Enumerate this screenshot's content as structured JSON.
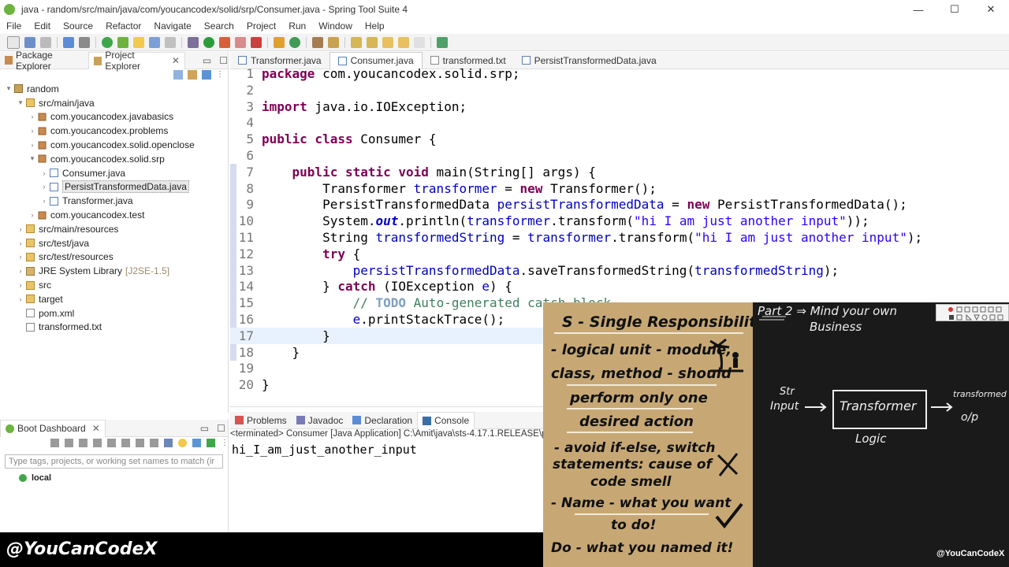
{
  "window": {
    "title": "java - random/src/main/java/com/youcancodex/solid/srp/Consumer.java - Spring Tool Suite 4",
    "minimize": "—",
    "maximize": "☐",
    "close": "✕"
  },
  "menu": [
    "File",
    "Edit",
    "Source",
    "Refactor",
    "Navigate",
    "Search",
    "Project",
    "Run",
    "Window",
    "Help"
  ],
  "left_tabs": [
    {
      "label": "Package Explorer",
      "icon": "package-explorer-icon"
    },
    {
      "label": "Project Explorer",
      "icon": "project-explorer-icon"
    }
  ],
  "tree": [
    {
      "label": "random",
      "icon": "project-icon",
      "indent": 0,
      "toggle": "▾"
    },
    {
      "label": "src/main/java",
      "icon": "source-folder-icon",
      "indent": 1,
      "toggle": "▾"
    },
    {
      "label": "com.youcancodex.javabasics",
      "icon": "package-icon",
      "indent": 2,
      "toggle": "›"
    },
    {
      "label": "com.youcancodex.problems",
      "icon": "package-icon",
      "indent": 2,
      "toggle": "›"
    },
    {
      "label": "com.youcancodex.solid.openclose",
      "icon": "package-icon",
      "indent": 2,
      "toggle": "›"
    },
    {
      "label": "com.youcancodex.solid.srp",
      "icon": "package-icon",
      "indent": 2,
      "toggle": "▾"
    },
    {
      "label": "Consumer.java",
      "icon": "java-file-icon",
      "indent": 3,
      "toggle": "›"
    },
    {
      "label": "PersistTransformedData.java",
      "icon": "java-file-icon",
      "indent": 3,
      "toggle": "›",
      "selected": true
    },
    {
      "label": "Transformer.java",
      "icon": "java-file-icon",
      "indent": 3,
      "toggle": "›"
    },
    {
      "label": "com.youcancodex.test",
      "icon": "package-icon",
      "indent": 2,
      "toggle": "›"
    },
    {
      "label": "src/main/resources",
      "icon": "source-folder-icon",
      "indent": 1,
      "toggle": "›"
    },
    {
      "label": "src/test/java",
      "icon": "source-folder-icon",
      "indent": 1,
      "toggle": "›"
    },
    {
      "label": "src/test/resources",
      "icon": "source-folder-icon",
      "indent": 1,
      "toggle": "›"
    },
    {
      "label": "JRE System Library",
      "suffix": "[J2SE-1.5]",
      "icon": "library-icon",
      "indent": 1,
      "toggle": "›"
    },
    {
      "label": "src",
      "icon": "folder-icon",
      "indent": 1,
      "toggle": "›"
    },
    {
      "label": "target",
      "icon": "folder-icon",
      "indent": 1,
      "toggle": "›"
    },
    {
      "label": "pom.xml",
      "icon": "xml-file-icon",
      "indent": 1,
      "toggle": ""
    },
    {
      "label": "transformed.txt",
      "icon": "text-file-icon",
      "indent": 1,
      "toggle": ""
    }
  ],
  "boot": {
    "tab": "Boot Dashboard",
    "filter_placeholder": "Type tags, projects, or working set names to match (ir",
    "local": "local"
  },
  "editor_tabs": [
    {
      "label": "Transformer.java",
      "active": false
    },
    {
      "label": "Consumer.java",
      "active": true
    },
    {
      "label": "transformed.txt",
      "active": false
    },
    {
      "label": "PersistTransformedData.java",
      "active": false
    }
  ],
  "code": [
    {
      "n": "1",
      "html": "<span class=\"kw\">package</span> com.youcancodex.solid.srp;"
    },
    {
      "n": "2",
      "html": ""
    },
    {
      "n": "3",
      "html": "<span class=\"kw\">import</span> java.io.IOException;"
    },
    {
      "n": "4",
      "html": ""
    },
    {
      "n": "5",
      "html": "<span class=\"kw\">public class</span> Consumer {"
    },
    {
      "n": "6",
      "html": ""
    },
    {
      "n": "7",
      "html": "    <span class=\"kw\">public static void</span> main(String[] args) {"
    },
    {
      "n": "8",
      "html": "        Transformer <span class=\"fld\">transformer</span> = <span class=\"kw\">new</span> Transformer();"
    },
    {
      "n": "9",
      "html": "        PersistTransformedData <span class=\"fld\">persistTransformedData</span> = <span class=\"kw\">new</span> PersistTransformedData();"
    },
    {
      "n": "10",
      "html": "        System.<span class=\"stat\">out</span>.println(<span class=\"fld\">transformer</span>.transform(<span class=\"str\">\"hi I am just another input\"</span>));"
    },
    {
      "n": "11",
      "html": "        String <span class=\"fld\">transformedString</span> = <span class=\"fld\">transformer</span>.transform(<span class=\"str\">\"hi I am just another input\"</span>);"
    },
    {
      "n": "12",
      "html": "        <span class=\"kw\">try</span> {"
    },
    {
      "n": "13",
      "html": "            <span class=\"fld\">persistTransformedData</span>.saveTransformedString(<span class=\"fld\">transformedString</span>);"
    },
    {
      "n": "14",
      "html": "        } <span class=\"kw\">catch</span> (IOException <span class=\"fld\">e</span>) {"
    },
    {
      "n": "15",
      "html": "            <span class=\"cmt\">// </span><span class=\"todo\">TODO</span><span class=\"cmt\"> Auto-generated catch block</span>"
    },
    {
      "n": "16",
      "html": "            <span class=\"fld\">e</span>.printStackTrace();"
    },
    {
      "n": "17",
      "html": "        }"
    },
    {
      "n": "18",
      "html": "    }"
    },
    {
      "n": "19",
      "html": ""
    },
    {
      "n": "20",
      "html": "}"
    }
  ],
  "console_tabs": [
    {
      "label": "Problems",
      "active": false
    },
    {
      "label": "Javadoc",
      "active": false
    },
    {
      "label": "Declaration",
      "active": false
    },
    {
      "label": "Console",
      "active": true
    }
  ],
  "console_status": "<terminated> Consumer [Java Application] C:\\Amit\\java\\sts-4.17.1.RELEASE\\p",
  "console_output": "hi_I_am_just_another_input",
  "banner": "@YouCanCodeX",
  "notes": [
    "S - Single Responsibility",
    "- logical unit - module,",
    "class, method - should",
    "perform only one",
    "desired action",
    "- avoid if-else, switch",
    "statements: cause of",
    "code smell",
    "- Name - what you want",
    "to do!",
    "Do - what you named it!"
  ],
  "board": {
    "title": "Part 2 ⇒ Mind your own",
    "title2": "Business",
    "input": "Str",
    "input2": "Input",
    "box": "Transformer",
    "box_caption": "Logic",
    "output": "transformed",
    "output2": "o/p",
    "watermark": "@YouCanCodeX"
  }
}
